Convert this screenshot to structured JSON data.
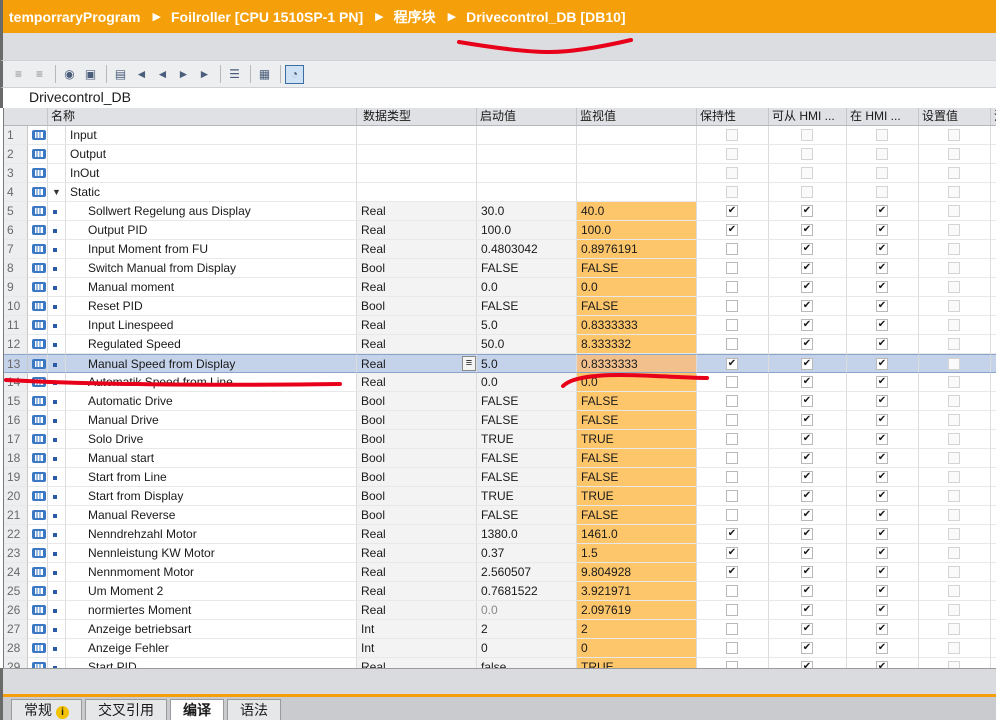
{
  "breadcrumb": {
    "items": [
      "temporraryProgram",
      "Foilroller [CPU 1510SP-1 PN]",
      "程序块",
      "Drivecontrol_DB [DB10]"
    ]
  },
  "toolbar": {
    "icons": [
      "insert-row-icon",
      "add-row-icon",
      "snapshot-icon",
      "copy-snapshot-icon",
      "load-start-values-icon",
      "reset-start-values-icon",
      "monitor-values-icon",
      "snapshot-load-icon",
      "snapshot-monitor-icon",
      "expand-all-icon",
      "keep-actual-icon",
      "monitor-all-icon"
    ]
  },
  "db_title": "Drivecontrol_DB",
  "columns": [
    "名称",
    "数据类型",
    "启动值",
    "监视值",
    "保持性",
    "可从 HMI ...",
    "在 HMI ...",
    "设置值",
    "注"
  ],
  "rows": [
    {
      "num": "1",
      "name": "Input",
      "type": "",
      "start": "",
      "mon": "",
      "ret": false,
      "hmi1": false,
      "hmi2": false,
      "set": false,
      "level": 0,
      "section": true
    },
    {
      "num": "2",
      "name": "Output",
      "type": "",
      "start": "",
      "mon": "",
      "ret": false,
      "hmi1": false,
      "hmi2": false,
      "set": false,
      "level": 0,
      "section": true
    },
    {
      "num": "3",
      "name": "InOut",
      "type": "",
      "start": "",
      "mon": "",
      "ret": false,
      "hmi1": false,
      "hmi2": false,
      "set": false,
      "level": 0,
      "section": true
    },
    {
      "num": "4",
      "name": "Static",
      "type": "",
      "start": "",
      "mon": "",
      "ret": false,
      "hmi1": false,
      "hmi2": false,
      "set": false,
      "level": 0,
      "section": true,
      "expanded": true
    },
    {
      "num": "5",
      "name": "Sollwert Regelung aus Display",
      "type": "Real",
      "start": "30.0",
      "mon": "40.0",
      "ret": true,
      "hmi1": true,
      "hmi2": true,
      "set": false,
      "level": 1
    },
    {
      "num": "6",
      "name": "Output PID",
      "type": "Real",
      "start": "100.0",
      "mon": "100.0",
      "ret": true,
      "hmi1": true,
      "hmi2": true,
      "set": false,
      "level": 1
    },
    {
      "num": "7",
      "name": "Input Moment from FU",
      "type": "Real",
      "start": "0.4803042",
      "mon": "0.8976191",
      "ret": false,
      "hmi1": true,
      "hmi2": true,
      "set": false,
      "level": 1
    },
    {
      "num": "8",
      "name": "Switch Manual from Display",
      "type": "Bool",
      "start": "FALSE",
      "mon": "FALSE",
      "ret": false,
      "hmi1": true,
      "hmi2": true,
      "set": false,
      "level": 1
    },
    {
      "num": "9",
      "name": "Manual moment",
      "type": "Real",
      "start": "0.0",
      "mon": "0.0",
      "ret": false,
      "hmi1": true,
      "hmi2": true,
      "set": false,
      "level": 1
    },
    {
      "num": "10",
      "name": "Reset PID",
      "type": "Bool",
      "start": "FALSE",
      "mon": "FALSE",
      "ret": false,
      "hmi1": true,
      "hmi2": true,
      "set": false,
      "level": 1
    },
    {
      "num": "11",
      "name": "Input Linespeed",
      "type": "Real",
      "start": "5.0",
      "mon": "0.8333333",
      "ret": false,
      "hmi1": true,
      "hmi2": true,
      "set": false,
      "level": 1
    },
    {
      "num": "12",
      "name": "Regulated Speed",
      "type": "Real",
      "start": "50.0",
      "mon": "8.333332",
      "ret": false,
      "hmi1": true,
      "hmi2": true,
      "set": false,
      "level": 1
    },
    {
      "num": "13",
      "name": "Manual Speed from Display",
      "type": "Real",
      "start": "5.0",
      "mon": "0.8333333",
      "ret": true,
      "hmi1": true,
      "hmi2": true,
      "set": false,
      "level": 1,
      "selected": true
    },
    {
      "num": "14",
      "name": "Automatik Speed from Line",
      "type": "Real",
      "start": "0.0",
      "mon": "0.0",
      "ret": false,
      "hmi1": true,
      "hmi2": true,
      "set": false,
      "level": 1
    },
    {
      "num": "15",
      "name": "Automatic Drive",
      "type": "Bool",
      "start": "FALSE",
      "mon": "FALSE",
      "ret": false,
      "hmi1": true,
      "hmi2": true,
      "set": false,
      "level": 1
    },
    {
      "num": "16",
      "name": "Manual Drive",
      "type": "Bool",
      "start": "FALSE",
      "mon": "FALSE",
      "ret": false,
      "hmi1": true,
      "hmi2": true,
      "set": false,
      "level": 1
    },
    {
      "num": "17",
      "name": "Solo Drive",
      "type": "Bool",
      "start": "TRUE",
      "mon": "TRUE",
      "ret": false,
      "hmi1": true,
      "hmi2": true,
      "set": false,
      "level": 1
    },
    {
      "num": "18",
      "name": "Manual start",
      "type": "Bool",
      "start": "FALSE",
      "mon": "FALSE",
      "ret": false,
      "hmi1": true,
      "hmi2": true,
      "set": false,
      "level": 1
    },
    {
      "num": "19",
      "name": "Start from Line",
      "type": "Bool",
      "start": "FALSE",
      "mon": "FALSE",
      "ret": false,
      "hmi1": true,
      "hmi2": true,
      "set": false,
      "level": 1
    },
    {
      "num": "20",
      "name": "Start from Display",
      "type": "Bool",
      "start": "TRUE",
      "mon": "TRUE",
      "ret": false,
      "hmi1": true,
      "hmi2": true,
      "set": false,
      "level": 1
    },
    {
      "num": "21",
      "name": "Manual Reverse",
      "type": "Bool",
      "start": "FALSE",
      "mon": "FALSE",
      "ret": false,
      "hmi1": true,
      "hmi2": true,
      "set": false,
      "level": 1
    },
    {
      "num": "22",
      "name": "Nenndrehzahl Motor",
      "type": "Real",
      "start": "1380.0",
      "mon": "1461.0",
      "ret": true,
      "hmi1": true,
      "hmi2": true,
      "set": false,
      "level": 1
    },
    {
      "num": "23",
      "name": "Nennleistung KW Motor",
      "type": "Real",
      "start": "0.37",
      "mon": "1.5",
      "ret": true,
      "hmi1": true,
      "hmi2": true,
      "set": false,
      "level": 1
    },
    {
      "num": "24",
      "name": "Nennmoment Motor",
      "type": "Real",
      "start": "2.560507",
      "mon": "9.804928",
      "ret": true,
      "hmi1": true,
      "hmi2": true,
      "set": false,
      "level": 1
    },
    {
      "num": "25",
      "name": "Um Moment 2",
      "type": "Real",
      "start": "0.7681522",
      "mon": "3.921971",
      "ret": false,
      "hmi1": true,
      "hmi2": true,
      "set": false,
      "level": 1
    },
    {
      "num": "26",
      "name": "normiertes Moment",
      "type": "Real",
      "start": "0.0",
      "mon": "2.097619",
      "ret": false,
      "hmi1": true,
      "hmi2": true,
      "set": false,
      "level": 1,
      "start_dim": true
    },
    {
      "num": "27",
      "name": "Anzeige betriebsart",
      "type": "Int",
      "start": "2",
      "mon": "2",
      "ret": false,
      "hmi1": true,
      "hmi2": true,
      "set": false,
      "level": 1
    },
    {
      "num": "28",
      "name": "Anzeige Fehler",
      "type": "Int",
      "start": "0",
      "mon": "0",
      "ret": false,
      "hmi1": true,
      "hmi2": true,
      "set": false,
      "level": 1
    },
    {
      "num": "29",
      "name": "Start PID",
      "type": "Real",
      "start": "false",
      "mon": "TRUE",
      "ret": false,
      "hmi1": true,
      "hmi2": true,
      "set": false,
      "level": 1
    }
  ],
  "bottom_tabs": [
    {
      "label": "常规",
      "warn": "i"
    },
    {
      "label": "交叉引用"
    },
    {
      "label": "编译",
      "active": true
    },
    {
      "label": "语法"
    }
  ],
  "colors": {
    "accent": "#f5a00a",
    "monitor": "#fdc66b",
    "selection": "#c5d3ea",
    "annotation": "#e8001a"
  }
}
